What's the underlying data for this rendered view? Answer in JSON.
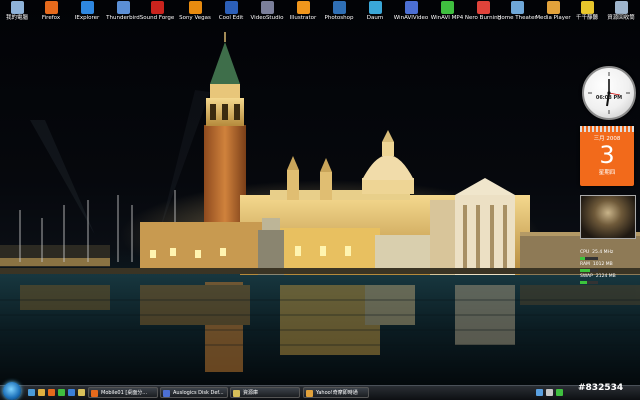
{
  "desktop_icons": [
    {
      "label": "我的電腦",
      "icon": "computer-icon",
      "color": "#8fb3d9"
    },
    {
      "label": "Firefox",
      "icon": "firefox-icon",
      "color": "#e66a1c"
    },
    {
      "label": "IExplorer",
      "icon": "ie-icon",
      "color": "#2e87e0"
    },
    {
      "label": "Thunderbird",
      "icon": "thunderbird-icon",
      "color": "#5b8fd6"
    },
    {
      "label": "Sound Forge",
      "icon": "soundforge-icon",
      "color": "#c9231d"
    },
    {
      "label": "Sony Vegas",
      "icon": "vegas-icon",
      "color": "#e88b0f"
    },
    {
      "label": "Cool Edit",
      "icon": "cooledit-icon",
      "color": "#2c5fb8"
    },
    {
      "label": "VideoStudio",
      "icon": "videostudio-icon",
      "color": "#7b7f9a"
    },
    {
      "label": "Illustrator",
      "icon": "illustrator-icon",
      "color": "#f0961c"
    },
    {
      "label": "Photoshop",
      "icon": "photoshop-icon",
      "color": "#2f6fb5"
    },
    {
      "label": "Daum",
      "icon": "daum-icon",
      "color": "#3aa7d8"
    },
    {
      "label": "WinAVIVideo",
      "icon": "winavi-icon",
      "color": "#4c6fd3"
    },
    {
      "label": "WinAVI MP4",
      "icon": "winavimp4-icon",
      "color": "#3fbf3f"
    },
    {
      "label": "Nero Burning",
      "icon": "nero-icon",
      "color": "#e0433a"
    },
    {
      "label": "Home Theater",
      "icon": "hometheater-icon",
      "color": "#6fa7d8"
    },
    {
      "label": "Media Player",
      "icon": "mediaplayer-icon",
      "color": "#e2a23b"
    },
    {
      "label": "千千靜聽",
      "icon": "ttplayer-icon",
      "color": "#e8c62c"
    },
    {
      "label": "資源回收筒",
      "icon": "recycle-bin-icon",
      "color": "#9fb5cc"
    }
  ],
  "gadgets": {
    "clock": {
      "time": "06:08 PM"
    },
    "calendar": {
      "month": "三月 2008",
      "day": "3",
      "weekday": "星期四"
    },
    "meter": {
      "rows": [
        {
          "label": "CPU",
          "value": "25.4 MHz",
          "pct": 25
        },
        {
          "label": "RAM",
          "value": "1012 MB",
          "pct": 55
        },
        {
          "label": "SWAP",
          "value": "2124 MB",
          "pct": 40
        }
      ]
    }
  },
  "taskbar": {
    "quick_launch": [
      {
        "icon": "show-desktop-icon",
        "color": "#4a9ad8"
      },
      {
        "icon": "explorer-icon",
        "color": "#e0b040"
      },
      {
        "icon": "firefox-icon",
        "color": "#e66a1c"
      },
      {
        "icon": "media-icon",
        "color": "#3fbf3f"
      },
      {
        "icon": "messenger-icon",
        "color": "#3a7fd8"
      },
      {
        "icon": "folder-icon",
        "color": "#d8c05a"
      }
    ],
    "windows": [
      {
        "label": "Mobile01 [桌面分...",
        "icon_color": "#e66a1c"
      },
      {
        "label": "Auslogics Disk Def...",
        "icon_color": "#4c6fd3"
      },
      {
        "label": "資源庫",
        "icon_color": "#d8c05a"
      },
      {
        "label": "Yahoo!奇摩即時通",
        "icon_color": "#e2a23b"
      }
    ],
    "tray": [
      {
        "icon": "network-icon",
        "color": "#5aa0e0"
      },
      {
        "icon": "volume-icon",
        "color": "#c8c8c8"
      },
      {
        "icon": "shield-icon",
        "color": "#3fbf3f"
      }
    ],
    "watermark": "#832534"
  }
}
